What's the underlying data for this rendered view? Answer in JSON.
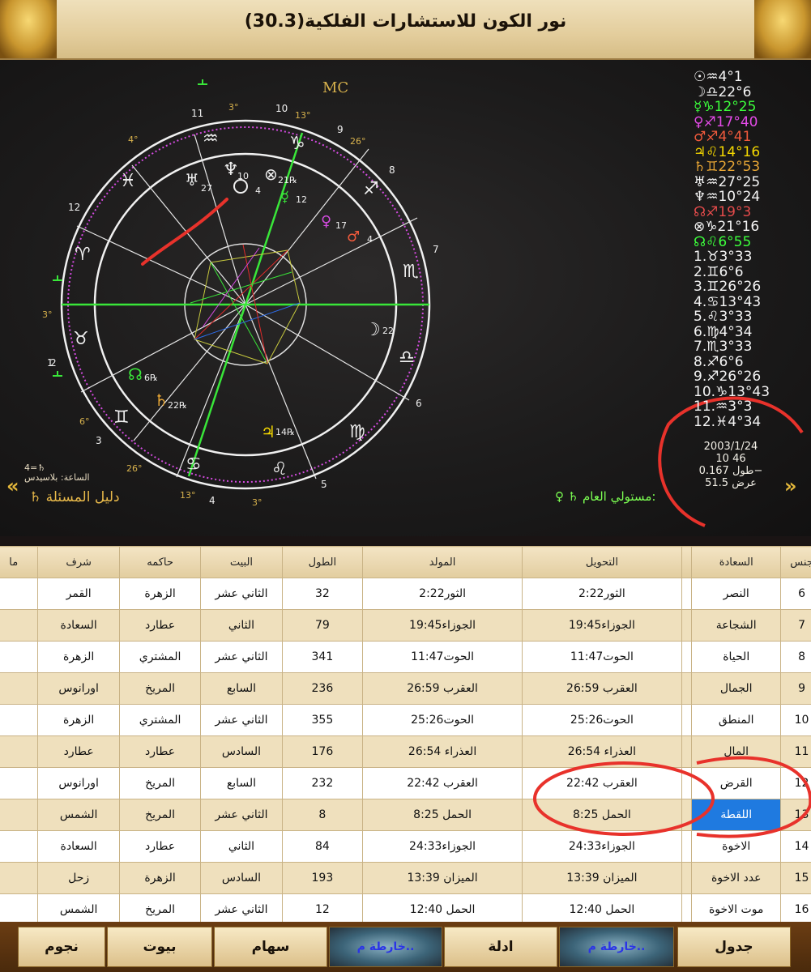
{
  "app": {
    "title": "نور الكون للاستشارات الفلكية(30.3)"
  },
  "chart": {
    "mc_label": "MC",
    "house_numbers": [
      "11",
      "10",
      "9",
      "8",
      "7",
      "6",
      "5",
      "4",
      "3",
      "2",
      "1",
      "12"
    ],
    "sign_degrees": [
      "3°",
      "13°",
      "26°",
      "4°",
      "3°",
      "6°",
      "26°",
      "13°",
      "3°"
    ],
    "planets_in_wheel": [
      {
        "glyph": "♅",
        "deg": "27"
      },
      {
        "glyph": "♆",
        "deg": "10"
      },
      {
        "glyph": "☉",
        "deg": "4"
      },
      {
        "glyph": "⊗",
        "deg": "21℞"
      },
      {
        "glyph": "☿",
        "deg": "12"
      },
      {
        "glyph": "♀",
        "deg": "17"
      },
      {
        "glyph": "♂",
        "deg": "4"
      },
      {
        "glyph": "☽",
        "deg": "22"
      },
      {
        "glyph": "♃",
        "deg": "14℞"
      },
      {
        "glyph": "♄",
        "deg": "22℞"
      },
      {
        "glyph": "☊",
        "deg": "6℞"
      }
    ],
    "colors": {
      "green": "#39e639",
      "white": "#f2f2f2",
      "gold": "#e3c45a",
      "magenta": "#d44be0",
      "red": "#e8322b"
    }
  },
  "planet_list": [
    {
      "text": "☉♒4°1",
      "color": "#f5f5f5"
    },
    {
      "text": "☽♎22°6",
      "color": "#f5f5f5"
    },
    {
      "text": "☿♑12°25",
      "color": "#3cff3c"
    },
    {
      "text": "♀♐17°40",
      "color": "#e44be8"
    },
    {
      "text": "♂♐4°41",
      "color": "#f05a3c"
    },
    {
      "text": "♃♌14°16",
      "color": "#f5d800"
    },
    {
      "text": "♄♊22°53",
      "color": "#e8a635"
    },
    {
      "text": "♅♒27°25",
      "color": "#f5f5f5"
    },
    {
      "text": "♆♒10°24",
      "color": "#f5f5f5"
    },
    {
      "text": "☊♐19°3",
      "color": "#e44b4b"
    },
    {
      "text": "⊗♑21°16",
      "color": "#f5f5f5"
    },
    {
      "text": "☊♌6°55",
      "color": "#3cff3c"
    },
    {
      "text": "1.♉3°33",
      "color": "#f5f5f5"
    },
    {
      "text": "2.♊6°6",
      "color": "#f5f5f5"
    },
    {
      "text": "3.♊26°26",
      "color": "#f5f5f5"
    },
    {
      "text": "4.♋13°43",
      "color": "#f5f5f5"
    },
    {
      "text": "5.♌3°33",
      "color": "#f5f5f5"
    },
    {
      "text": "6.♍4°34",
      "color": "#f5f5f5"
    },
    {
      "text": "7.♏3°33",
      "color": "#f5f5f5"
    },
    {
      "text": "8.♐6°6",
      "color": "#f5f5f5"
    },
    {
      "text": "9.♐26°26",
      "color": "#f5f5f5"
    },
    {
      "text": "10.♑13°43",
      "color": "#f5f5f5"
    },
    {
      "text": "11.♒3°3",
      "color": "#f5f5f5"
    },
    {
      "text": "12.♓4°34",
      "color": "#f5f5f5"
    }
  ],
  "info": {
    "date": "2003/1/24",
    "time": "10 46",
    "longitude": "طول 0.167−",
    "latitude": "عرض 51.5"
  },
  "footer": {
    "left_hour": "4=♄",
    "left_time_label": "الساعة: بلاسيدس",
    "left_title": "دليل المسئلة",
    "left_glyph": "♄",
    "right_label": "مستولي العام:",
    "right_glyphs": "♀ ♄"
  },
  "table": {
    "headers": [
      "جنس",
      "السعادة",
      "",
      "التحويل",
      "المولد",
      "الطول",
      "البيت",
      "حاكمه",
      "شرف",
      "ما"
    ],
    "rows": [
      {
        "num": "6",
        "name": "النصر",
        "tahwil": "الثور2:22",
        "mawlid": "الثور2:22",
        "tul": "32",
        "bayt": "الثاني عشر",
        "hakim": "الزهرة",
        "sharaf": "القمر"
      },
      {
        "num": "7",
        "name": "الشجاعة",
        "tahwil": "الجوزاء19:45",
        "mawlid": "الجوزاء19:45",
        "tul": "79",
        "bayt": "الثاني",
        "hakim": "عطارد",
        "sharaf": "السعادة"
      },
      {
        "num": "8",
        "name": "الحياة",
        "tahwil": "الحوت11:47",
        "mawlid": "الحوت11:47",
        "tul": "341",
        "bayt": "الثاني عشر",
        "hakim": "المشتري",
        "sharaf": "الزهرة"
      },
      {
        "num": "9",
        "name": "الجمال",
        "tahwil": "العقرب 26:59",
        "mawlid": "العقرب 26:59",
        "tul": "236",
        "bayt": "السابع",
        "hakim": "المريخ",
        "sharaf": "اورانوس"
      },
      {
        "num": "10",
        "name": "المنطق",
        "tahwil": "الحوت25:26",
        "mawlid": "الحوت25:26",
        "tul": "355",
        "bayt": "الثاني عشر",
        "hakim": "المشتري",
        "sharaf": "الزهرة"
      },
      {
        "num": "11",
        "name": "المال",
        "tahwil": "العذراء 26:54",
        "mawlid": "العذراء 26:54",
        "tul": "176",
        "bayt": "السادس",
        "hakim": "عطارد",
        "sharaf": "عطارد"
      },
      {
        "num": "12",
        "name": "القرض",
        "tahwil": "العقرب 22:42",
        "mawlid": "العقرب 22:42",
        "tul": "232",
        "bayt": "السابع",
        "hakim": "المريخ",
        "sharaf": "اورانوس"
      },
      {
        "num": "13",
        "name": "اللقطة",
        "tahwil": "الحمل 8:25",
        "mawlid": "الحمل 8:25",
        "tul": "8",
        "bayt": "الثاني عشر",
        "hakim": "المريخ",
        "sharaf": "الشمس"
      },
      {
        "num": "14",
        "name": "الاخوة",
        "tahwil": "الجوزاء24:33",
        "mawlid": "الجوزاء24:33",
        "tul": "84",
        "bayt": "الثاني",
        "hakim": "عطارد",
        "sharaf": "السعادة"
      },
      {
        "num": "15",
        "name": "عدد الاخوة",
        "tahwil": "الميزان 13:39",
        "mawlid": "الميزان 13:39",
        "tul": "193",
        "bayt": "السادس",
        "hakim": "الزهرة",
        "sharaf": "زحل"
      },
      {
        "num": "16",
        "name": "موت الاخوة",
        "tahwil": "الحمل 12:40",
        "mawlid": "الحمل 12:40",
        "tul": "12",
        "bayt": "الثاني عشر",
        "hakim": "المريخ",
        "sharaf": "الشمس"
      }
    ],
    "selected_index": 7
  },
  "bottom_tabs": [
    "جدول",
    "خارطة م..",
    "ادلة",
    "خارطة م..",
    "سهام",
    "بيوت",
    "نجوم"
  ]
}
